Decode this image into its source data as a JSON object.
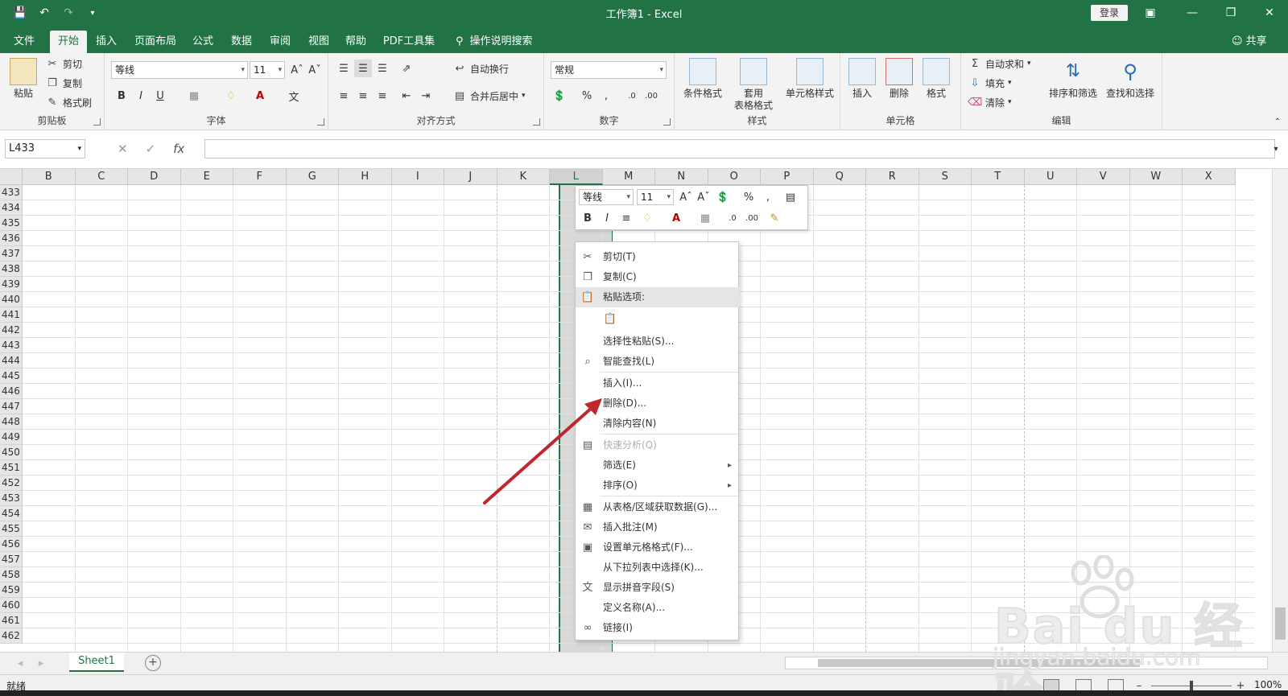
{
  "window": {
    "title": "工作簿1  -  Excel",
    "login": "登录",
    "share": "共享"
  },
  "tabs": [
    "文件",
    "开始",
    "插入",
    "页面布局",
    "公式",
    "数据",
    "审阅",
    "视图",
    "帮助",
    "PDF工具集"
  ],
  "tell_me": "操作说明搜索",
  "ribbon": {
    "clipboard": {
      "label": "剪贴板",
      "paste": "粘贴",
      "cut": "剪切",
      "copy": "复制",
      "format_painter": "格式刷"
    },
    "font": {
      "label": "字体",
      "font_name": "等线",
      "font_size": "11"
    },
    "alignment": {
      "label": "对齐方式",
      "wrap": "自动换行",
      "merge": "合并后居中"
    },
    "number": {
      "label": "数字",
      "format": "常规"
    },
    "styles": {
      "label": "样式",
      "conditional": "条件格式",
      "table_line1": "套用",
      "table_line2": "表格格式",
      "cell_styles": "单元格样式"
    },
    "cells": {
      "label": "单元格",
      "insert": "插入",
      "delete": "删除",
      "format": "格式"
    },
    "editing": {
      "label": "编辑",
      "autosum": "自动求和",
      "fill": "填充",
      "clear": "清除",
      "sort_filter": "排序和筛选",
      "find_select": "查找和选择"
    }
  },
  "formula_bar": {
    "name_box": "L433",
    "fx": "fx"
  },
  "columns": [
    "B",
    "C",
    "D",
    "E",
    "F",
    "G",
    "H",
    "I",
    "J",
    "K",
    "L",
    "M",
    "N",
    "O",
    "P",
    "Q",
    "R",
    "S",
    "T",
    "U",
    "V",
    "W",
    "X"
  ],
  "selected_column": "L",
  "rows": [
    "433",
    "434",
    "435",
    "436",
    "437",
    "438",
    "439",
    "440",
    "441",
    "442",
    "443",
    "444",
    "445",
    "446",
    "447",
    "448",
    "449",
    "450",
    "451",
    "452",
    "453",
    "454",
    "455",
    "456",
    "457",
    "458",
    "459",
    "460",
    "461",
    "462"
  ],
  "mini_toolbar": {
    "font_name": "等线",
    "font_size": "11"
  },
  "context_menu": {
    "items": [
      {
        "label": "剪切(T)",
        "icon": "scissors-icon"
      },
      {
        "label": "复制(C)",
        "icon": "copy-icon"
      },
      {
        "label": "粘贴选项:",
        "icon": "paste-icon",
        "highlight": true
      },
      {
        "label": "选择性粘贴(S)..."
      },
      {
        "label": "智能查找(L)",
        "icon": "search-icon"
      },
      {
        "label": "插入(I)..."
      },
      {
        "label": "删除(D)..."
      },
      {
        "label": "清除内容(N)"
      },
      {
        "label": "快速分析(Q)",
        "icon": "quick-analysis-icon",
        "disabled": true
      },
      {
        "label": "筛选(E)",
        "submenu": true
      },
      {
        "label": "排序(O)",
        "submenu": true
      },
      {
        "label": "从表格/区域获取数据(G)...",
        "icon": "table-icon"
      },
      {
        "label": "插入批注(M)",
        "icon": "comment-icon"
      },
      {
        "label": "设置单元格格式(F)...",
        "icon": "format-cells-icon"
      },
      {
        "label": "从下拉列表中选择(K)..."
      },
      {
        "label": "显示拼音字段(S)",
        "icon": "phonetic-icon"
      },
      {
        "label": "定义名称(A)..."
      },
      {
        "label": "链接(I)",
        "icon": "link-icon"
      }
    ]
  },
  "sheets": [
    "Sheet1"
  ],
  "status": {
    "ready": "就绪",
    "zoom": "100%"
  },
  "watermark": {
    "brand": "Bai du 经验",
    "url": "jingyan.baidu.com"
  },
  "colors": {
    "excel_green": "#217346",
    "arrow": "#c0272d"
  }
}
